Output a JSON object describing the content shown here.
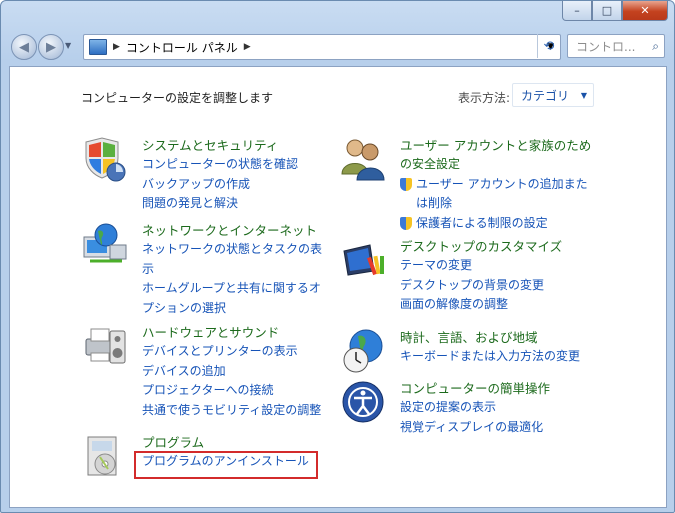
{
  "titlebar": {
    "min": "–",
    "max": "□",
    "close": "✕"
  },
  "nav": {
    "back_icon": "back-arrow-icon",
    "forward_icon": "forward-arrow-icon",
    "address": "コントロール パネル",
    "search_placeholder": "コントロ...",
    "refresh_icon": "refresh-icon"
  },
  "main": {
    "heading": "コンピューターの設定を調整します",
    "viewby_label": "表示方法:",
    "viewby_value": "カテゴリ",
    "categories": [
      {
        "title": "システムとセキュリティ",
        "icon": "shield-icon",
        "links": [
          "コンピューターの状態を確認",
          "バックアップの作成",
          "問題の発見と解決"
        ]
      },
      {
        "title": "ネットワークとインターネット",
        "icon": "network-icon",
        "links": [
          "ネットワークの状態とタスクの表",
          "示",
          "ホームグループと共有に関するオ",
          "プションの選択"
        ]
      },
      {
        "title": "ハードウェアとサウンド",
        "icon": "printer-icon",
        "links": [
          "デバイスとプリンターの表示",
          "デバイスの追加",
          "プロジェクターへの接続",
          "共通で使うモビリティ設定の調整"
        ]
      },
      {
        "title": "プログラム",
        "icon": "programs-icon",
        "links": [
          "プログラムのアンインストール"
        ]
      },
      {
        "title": "ユーザー アカウントと家族のため",
        "title2": "の安全設定",
        "icon": "users-icon",
        "links": [
          "ユーザー アカウントの追加また",
          "は削除",
          "保護者による制限の設定"
        ]
      },
      {
        "title": "デスクトップのカスタマイズ",
        "icon": "desktop-icon",
        "links": [
          "テーマの変更",
          "デスクトップの背景の変更",
          "画面の解像度の調整"
        ]
      },
      {
        "title": "時計、言語、および地域",
        "icon": "clock-globe-icon",
        "links": [
          "キーボードまたは入力方法の変更"
        ]
      },
      {
        "title": "コンピューターの簡単操作",
        "icon": "ease-of-access-icon",
        "links": [
          "設定の提案の表示",
          "視覚ディスプレイの最適化"
        ]
      }
    ]
  },
  "colors": {
    "title_green": "#1c6a1c",
    "link_blue": "#1653b7",
    "highlight_red": "#d32b2b"
  }
}
